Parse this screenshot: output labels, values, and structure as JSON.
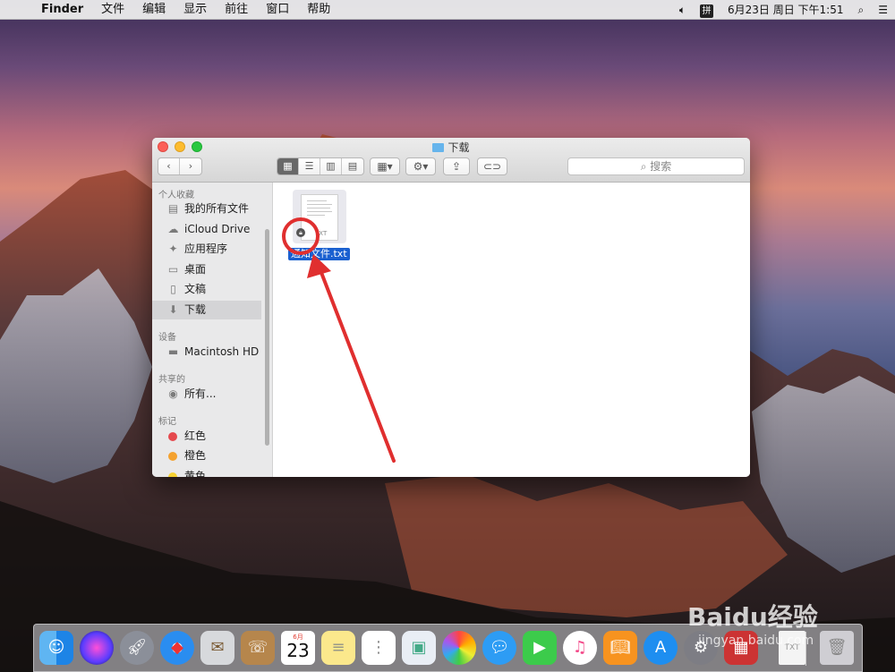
{
  "menubar": {
    "app": "Finder",
    "items": [
      "文件",
      "编辑",
      "显示",
      "前往",
      "窗口",
      "帮助"
    ],
    "ime": "拼",
    "clock": "6月23日 周日 下午1:51"
  },
  "window": {
    "title": "下载",
    "nav_back": "‹",
    "nav_forward": "›",
    "search_placeholder": "搜索"
  },
  "sidebar": {
    "sections": {
      "favorites": "个人收藏",
      "devices": "设备",
      "shared": "共享的",
      "tags": "标记"
    },
    "favorites": [
      {
        "label": "我的所有文件",
        "icon": "all-files-icon"
      },
      {
        "label": "iCloud Drive",
        "icon": "cloud-icon"
      },
      {
        "label": "应用程序",
        "icon": "applications-icon"
      },
      {
        "label": "桌面",
        "icon": "desktop-icon"
      },
      {
        "label": "文稿",
        "icon": "documents-icon"
      },
      {
        "label": "下载",
        "icon": "download-icon",
        "selected": true
      }
    ],
    "devices": [
      {
        "label": "Macintosh HD",
        "icon": "disk-icon"
      }
    ],
    "shared": [
      {
        "label": "所有...",
        "icon": "network-icon"
      }
    ],
    "tags": [
      {
        "label": "红色",
        "color": "#e5484d"
      },
      {
        "label": "橙色",
        "color": "#f4a230"
      },
      {
        "label": "黄色",
        "color": "#f5d132"
      }
    ]
  },
  "content": {
    "file": {
      "name": "通知文件.txt",
      "ext": "TXT",
      "locked": true
    }
  },
  "dock": {
    "calendar": {
      "month": "6月",
      "day": "23"
    },
    "apps": [
      "Finder",
      "Siri",
      "Launchpad",
      "Safari",
      "Mail",
      "Contacts",
      "Calendar",
      "Notes",
      "Reminders",
      "Preview",
      "Photos",
      "Messages",
      "FaceTime",
      "iTunes",
      "iBooks",
      "App Store",
      "System Preferences",
      "Photo Booth",
      "Document",
      "Trash"
    ]
  },
  "watermark": {
    "brand": "Baidu经验",
    "url": "jingyan.baidu.com"
  }
}
